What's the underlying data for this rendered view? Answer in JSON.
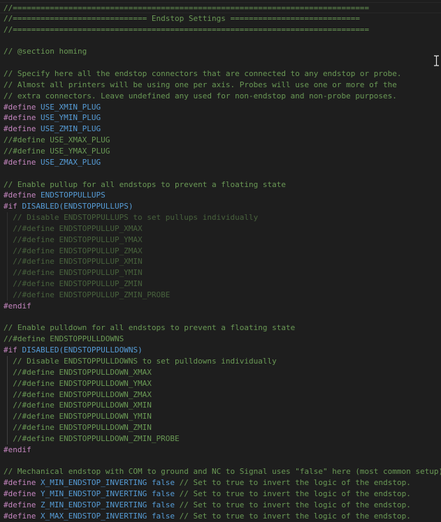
{
  "editor": {
    "lines": [
      {
        "segments": [
          {
            "t": "//=============================================================================",
            "c": "comment"
          }
        ],
        "current": true
      },
      {
        "segments": [
          {
            "t": "//============================= Endstop Settings ============================",
            "c": "comment"
          }
        ]
      },
      {
        "segments": [
          {
            "t": "//=============================================================================",
            "c": "comment"
          }
        ]
      },
      {
        "segments": []
      },
      {
        "segments": [
          {
            "t": "// @section homing",
            "c": "comment"
          }
        ]
      },
      {
        "segments": []
      },
      {
        "segments": [
          {
            "t": "// Specify here all the endstop connectors that are connected to any endstop or probe.",
            "c": "comment"
          }
        ]
      },
      {
        "segments": [
          {
            "t": "// Almost all printers will be using one per axis. Probes will use one or more of the",
            "c": "comment"
          }
        ]
      },
      {
        "segments": [
          {
            "t": "// extra connectors. Leave undefined any used for non-endstop and non-probe purposes.",
            "c": "comment"
          }
        ]
      },
      {
        "segments": [
          {
            "t": "#define",
            "c": "kw"
          },
          {
            "t": " ",
            "c": "plain"
          },
          {
            "t": "USE_XMIN_PLUG",
            "c": "macro"
          }
        ]
      },
      {
        "segments": [
          {
            "t": "#define",
            "c": "kw"
          },
          {
            "t": " ",
            "c": "plain"
          },
          {
            "t": "USE_YMIN_PLUG",
            "c": "macro"
          }
        ]
      },
      {
        "segments": [
          {
            "t": "#define",
            "c": "kw"
          },
          {
            "t": " ",
            "c": "plain"
          },
          {
            "t": "USE_ZMIN_PLUG",
            "c": "macro"
          }
        ]
      },
      {
        "segments": [
          {
            "t": "//#define USE_XMAX_PLUG",
            "c": "comment"
          }
        ]
      },
      {
        "segments": [
          {
            "t": "//#define USE_YMAX_PLUG",
            "c": "comment"
          }
        ]
      },
      {
        "segments": [
          {
            "t": "#define",
            "c": "kw"
          },
          {
            "t": " ",
            "c": "plain"
          },
          {
            "t": "USE_ZMAX_PLUG",
            "c": "macro"
          }
        ]
      },
      {
        "segments": []
      },
      {
        "segments": [
          {
            "t": "// Enable pullup for all endstops to prevent a floating state",
            "c": "comment"
          }
        ]
      },
      {
        "segments": [
          {
            "t": "#define",
            "c": "kw"
          },
          {
            "t": " ",
            "c": "plain"
          },
          {
            "t": "ENDSTOPPULLUPS",
            "c": "macro"
          }
        ]
      },
      {
        "segments": [
          {
            "t": "#if",
            "c": "kw"
          },
          {
            "t": " ",
            "c": "plain"
          },
          {
            "t": "DISABLED(ENDSTOPPULLUPS)",
            "c": "macro"
          }
        ]
      },
      {
        "segments": [
          {
            "t": "  // Disable ENDSTOPPULLUPS to set pullups individually",
            "c": "comment"
          }
        ],
        "guide": true,
        "dim": true
      },
      {
        "segments": [
          {
            "t": "  //#define ENDSTOPPULLUP_XMAX",
            "c": "comment"
          }
        ],
        "guide": true,
        "dim": true
      },
      {
        "segments": [
          {
            "t": "  //#define ENDSTOPPULLUP_YMAX",
            "c": "comment"
          }
        ],
        "guide": true,
        "dim": true
      },
      {
        "segments": [
          {
            "t": "  //#define ENDSTOPPULLUP_ZMAX",
            "c": "comment"
          }
        ],
        "guide": true,
        "dim": true
      },
      {
        "segments": [
          {
            "t": "  //#define ENDSTOPPULLUP_XMIN",
            "c": "comment"
          }
        ],
        "guide": true,
        "dim": true
      },
      {
        "segments": [
          {
            "t": "  //#define ENDSTOPPULLUP_YMIN",
            "c": "comment"
          }
        ],
        "guide": true,
        "dim": true
      },
      {
        "segments": [
          {
            "t": "  //#define ENDSTOPPULLUP_ZMIN",
            "c": "comment"
          }
        ],
        "guide": true,
        "dim": true
      },
      {
        "segments": [
          {
            "t": "  //#define ENDSTOPPULLUP_ZMIN_PROBE",
            "c": "comment"
          }
        ],
        "guide": true,
        "dim": true
      },
      {
        "segments": [
          {
            "t": "#endif",
            "c": "kw"
          }
        ]
      },
      {
        "segments": []
      },
      {
        "segments": [
          {
            "t": "// Enable pulldown for all endstops to prevent a floating state",
            "c": "comment"
          }
        ]
      },
      {
        "segments": [
          {
            "t": "//#define ENDSTOPPULLDOWNS",
            "c": "comment"
          }
        ]
      },
      {
        "segments": [
          {
            "t": "#if",
            "c": "kw"
          },
          {
            "t": " ",
            "c": "plain"
          },
          {
            "t": "DISABLED(ENDSTOPPULLDOWNS)",
            "c": "macro"
          }
        ]
      },
      {
        "segments": [
          {
            "t": "  // Disable ENDSTOPPULLDOWNS to set pulldowns individually",
            "c": "comment"
          }
        ],
        "guide": true
      },
      {
        "segments": [
          {
            "t": "  //#define ENDSTOPPULLDOWN_XMAX",
            "c": "comment"
          }
        ],
        "guide": true
      },
      {
        "segments": [
          {
            "t": "  //#define ENDSTOPPULLDOWN_YMAX",
            "c": "comment"
          }
        ],
        "guide": true
      },
      {
        "segments": [
          {
            "t": "  //#define ENDSTOPPULLDOWN_ZMAX",
            "c": "comment"
          }
        ],
        "guide": true
      },
      {
        "segments": [
          {
            "t": "  //#define ENDSTOPPULLDOWN_XMIN",
            "c": "comment"
          }
        ],
        "guide": true
      },
      {
        "segments": [
          {
            "t": "  //#define ENDSTOPPULLDOWN_YMIN",
            "c": "comment"
          }
        ],
        "guide": true
      },
      {
        "segments": [
          {
            "t": "  //#define ENDSTOPPULLDOWN_ZMIN",
            "c": "comment"
          }
        ],
        "guide": true
      },
      {
        "segments": [
          {
            "t": "  //#define ENDSTOPPULLDOWN_ZMIN_PROBE",
            "c": "comment"
          }
        ],
        "guide": true
      },
      {
        "segments": [
          {
            "t": "#endif",
            "c": "kw"
          }
        ]
      },
      {
        "segments": []
      },
      {
        "segments": [
          {
            "t": "// Mechanical endstop with COM to ground and NC to Signal uses \"false\" here (most common setup).",
            "c": "comment"
          }
        ]
      },
      {
        "segments": [
          {
            "t": "#define",
            "c": "kw"
          },
          {
            "t": " ",
            "c": "plain"
          },
          {
            "t": "X_MIN_ENDSTOP_INVERTING",
            "c": "macro"
          },
          {
            "t": " ",
            "c": "plain"
          },
          {
            "t": "false",
            "c": "bool"
          },
          {
            "t": " // Set to true to invert the logic of the endstop.",
            "c": "comment"
          }
        ]
      },
      {
        "segments": [
          {
            "t": "#define",
            "c": "kw"
          },
          {
            "t": " ",
            "c": "plain"
          },
          {
            "t": "Y_MIN_ENDSTOP_INVERTING",
            "c": "macro"
          },
          {
            "t": " ",
            "c": "plain"
          },
          {
            "t": "false",
            "c": "bool"
          },
          {
            "t": " // Set to true to invert the logic of the endstop.",
            "c": "comment"
          }
        ]
      },
      {
        "segments": [
          {
            "t": "#define",
            "c": "kw"
          },
          {
            "t": " ",
            "c": "plain"
          },
          {
            "t": "Z_MIN_ENDSTOP_INVERTING",
            "c": "macro"
          },
          {
            "t": " ",
            "c": "plain"
          },
          {
            "t": "false",
            "c": "bool"
          },
          {
            "t": " // Set to true to invert the logic of the endstop.",
            "c": "comment"
          }
        ]
      },
      {
        "segments": [
          {
            "t": "#define",
            "c": "kw"
          },
          {
            "t": " ",
            "c": "plain"
          },
          {
            "t": "X_MAX_ENDSTOP_INVERTING",
            "c": "macro"
          },
          {
            "t": " ",
            "c": "plain"
          },
          {
            "t": "false",
            "c": "bool"
          },
          {
            "t": " // Set to true to invert the logic of the endstop.",
            "c": "comment"
          }
        ]
      }
    ]
  },
  "theme": {
    "background": "#1e1e1e",
    "comment": "#6a9955",
    "preprocessor": "#c586c0",
    "macro": "#569cd6",
    "text": "#d4d4d4"
  },
  "cursor_icon": "text-ibeam-icon",
  "scrollbar_icon": "vertical-scrollbar"
}
